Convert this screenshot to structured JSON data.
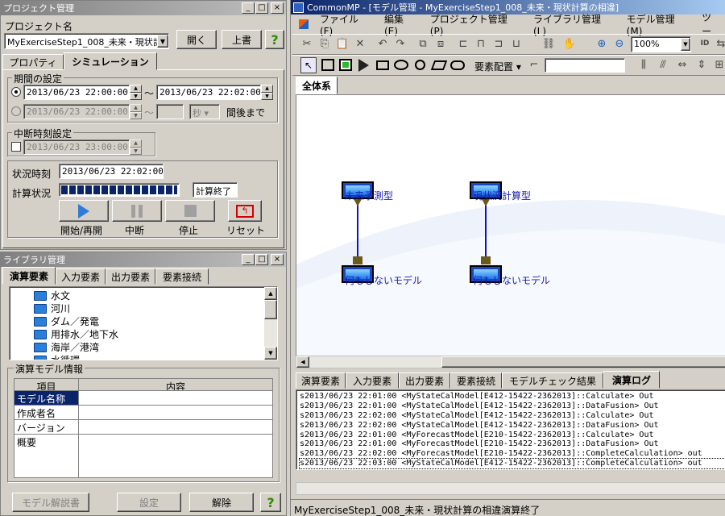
{
  "project_window": {
    "title": "プロジェクト管理",
    "project_name_label": "プロジェクト名",
    "project_name_value": "MyExerciseStep1_008_未来・現状計",
    "open_button": "開く",
    "overwrite_button": "上書",
    "help_button": "?",
    "tabs": [
      "プロパティ",
      "シミュレーション"
    ],
    "period_group": "期間の設定",
    "start_time": "2013/06/23 22:00:00",
    "tilde": "〜",
    "end_time": "2013/06/23 22:02:00",
    "alt_start_time": "2013/06/23 22:00:00",
    "alt_unit": "秒",
    "alt_suffix": "間後まで",
    "interrupt_group": "中断時刻設定",
    "interrupt_time": "2013/06/23 23:00:00",
    "status_time_label": "状況時刻",
    "status_time_value": "2013/06/23 22:02:00",
    "calc_status_label": "計算状況",
    "calc_progress": 1.0,
    "calc_status_text": "計算終了",
    "controls": [
      "開始/再開",
      "中断",
      "停止",
      "リセット"
    ]
  },
  "library_window": {
    "title": "ライブラリ管理",
    "tabs": [
      "演算要素",
      "入力要素",
      "出力要素",
      "要素接続"
    ],
    "tree_items": [
      "水文",
      "河川",
      "ダム／発電",
      "用排水／地下水",
      "海岸／港湾",
      "水循環"
    ],
    "model_info_group": "演算モデル情報",
    "grid_headers": [
      "項目",
      "内容"
    ],
    "grid_rows": [
      "モデル名称",
      "作成者名",
      "バージョン",
      "概要"
    ],
    "buttons": [
      "モデル解説書",
      "設定",
      "解除",
      "?"
    ]
  },
  "main_window": {
    "title": "CommonMP - [モデル管理 - MyExerciseStep1_008_未来・現状計算の相違]",
    "menu": [
      "ファイル(F)",
      "編集(E)",
      "プロジェクト管理(P)",
      "ライブラリ管理(L)",
      "モデル管理(M)",
      "ツー"
    ],
    "zoom": "100%",
    "layout_menu": "要素配置",
    "canvas_tab": "全体系",
    "nodes": [
      {
        "label": "未来予測型"
      },
      {
        "label": "現状況計算型"
      },
      {
        "label": "何もしないモデル"
      },
      {
        "label": "何もしないモデル"
      }
    ],
    "bottom_tabs": [
      "演算要素",
      "入力要素",
      "出力要素",
      "要素接続",
      "モデルチェック結果",
      "演算ログ"
    ],
    "log_lines": [
      "s2013/06/23 22:01:00 <MyStateCalModel[E412-15422-2362013]::Calculate> Out",
      "s2013/06/23 22:01:00 <MyStateCalModel[E412-15422-2362013]::DataFusion> Out",
      "s2013/06/23 22:02:00 <MyStateCalModel[E412-15422-2362013]::Calculate> Out",
      "s2013/06/23 22:02:00 <MyStateCalModel[E412-15422-2362013]::DataFusion> Out",
      "s2013/06/23 22:01:00 <MyForecastModel[E210-15422-2362013]::Calculate> Out",
      "s2013/06/23 22:01:00 <MyForecastModel[E210-15422-2362013]::DataFusion> Out",
      "s2013/06/23 22:02:00 <MyForecastModel[E210-15422-2362013]::CompleteCalculation> out",
      "s2013/06/23 22:03:00 <MyStateCalModel[E412-15422-2362013]::CompleteCalculation> out"
    ],
    "status_bar": "MyExerciseStep1_008_未来・現状計算の相違演算終了"
  }
}
